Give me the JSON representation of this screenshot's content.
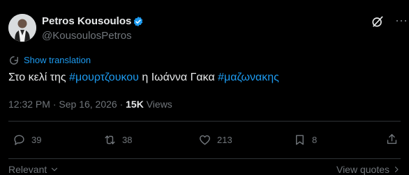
{
  "author": {
    "display_name": "Petros Kousoulos",
    "handle": "@KousoulosPetros"
  },
  "translation": {
    "label": "Show translation"
  },
  "tweet": {
    "text_1": "Στο κελί της ",
    "hashtag_1": "#μουρτζουκου",
    "text_2": " η Ιωάννα Γακα ",
    "hashtag_2": "#μαζωνακης"
  },
  "meta": {
    "time": "12:32 PM",
    "sep1": " · ",
    "date": "Sep 16, 2026",
    "sep2": " · ",
    "views_count": "15K",
    "views_label": " Views"
  },
  "actions": {
    "replies": "39",
    "reposts": "38",
    "likes": "213",
    "bookmarks": "8"
  },
  "footer": {
    "sort_label": "Relevant",
    "view_quotes": "View quotes"
  },
  "colors": {
    "accent": "#1d9bf0",
    "muted": "#71767b",
    "text": "#e7e9ea",
    "background": "#000000"
  }
}
